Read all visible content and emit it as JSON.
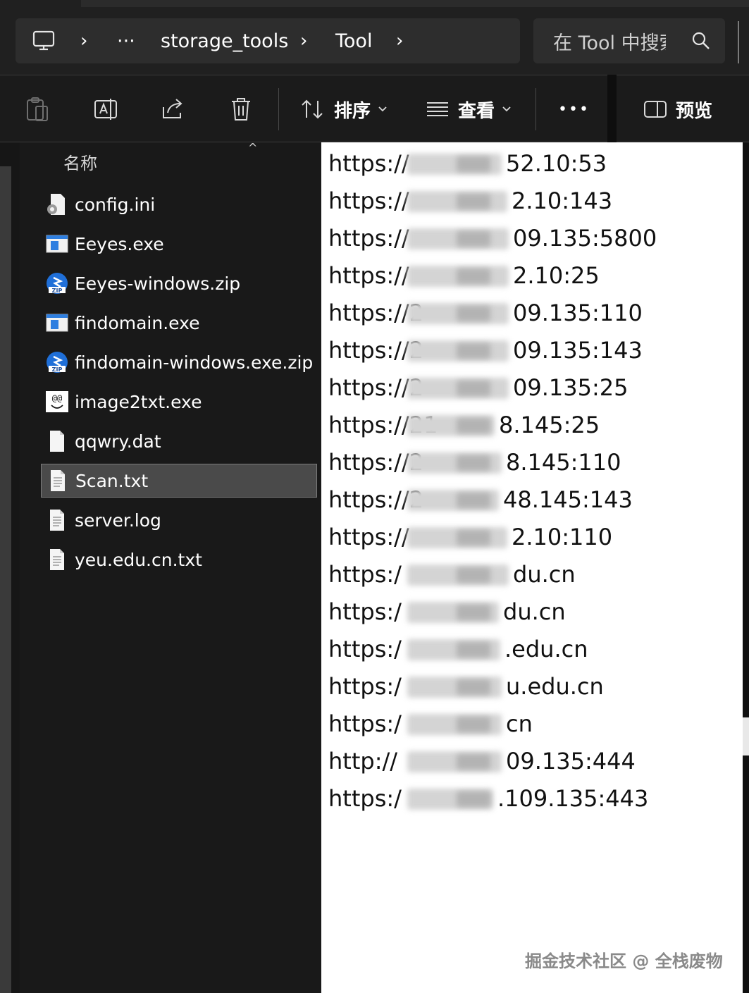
{
  "address_bar": {
    "breadcrumbs": [
      "storage_tools",
      "Tool"
    ],
    "more_label": "···",
    "search_placeholder": "在 Tool 中搜索"
  },
  "command_bar": {
    "sort_label": "排序",
    "view_label": "查看",
    "more_label": "•••",
    "preview_label": "预览"
  },
  "file_list": {
    "column_header": "名称",
    "files": [
      {
        "name": "config.ini",
        "icon": "settings-file-icon"
      },
      {
        "name": "Eeyes.exe",
        "icon": "exe-file-icon"
      },
      {
        "name": "Eeyes-windows.zip",
        "icon": "zip-file-icon"
      },
      {
        "name": "findomain.exe",
        "icon": "exe-file-icon"
      },
      {
        "name": "findomain-windows.exe.zip",
        "icon": "zip-file-icon"
      },
      {
        "name": "image2txt.exe",
        "icon": "image2txt-app-icon"
      },
      {
        "name": "qqwry.dat",
        "icon": "blank-file-icon"
      },
      {
        "name": "Scan.txt",
        "icon": "text-file-icon",
        "selected": true
      },
      {
        "name": "server.log",
        "icon": "text-file-icon"
      },
      {
        "name": "yeu.edu.cn.txt",
        "icon": "text-file-icon"
      }
    ]
  },
  "preview": {
    "lines": [
      {
        "prefix": "https://",
        "suffix": "52.10:53"
      },
      {
        "prefix": "https://",
        "suffix": "2.10:143"
      },
      {
        "prefix": "https://",
        "suffix": "09.135:5800"
      },
      {
        "prefix": "https://",
        "suffix": "2.10:25"
      },
      {
        "prefix": "https://2",
        "suffix": "09.135:110"
      },
      {
        "prefix": "https://2",
        "suffix": "09.135:143"
      },
      {
        "prefix": "https://2",
        "suffix": "09.135:25"
      },
      {
        "prefix": "https://21",
        "suffix": "8.145:25"
      },
      {
        "prefix": "https://2",
        "suffix": "8.145:110"
      },
      {
        "prefix": "https://2",
        "suffix": "48.145:143"
      },
      {
        "prefix": "https://",
        "suffix": "2.10:110"
      },
      {
        "prefix": "https:/",
        "suffix": "du.cn"
      },
      {
        "prefix": "https:/",
        "suffix": "du.cn"
      },
      {
        "prefix": "https:/",
        "suffix": ".edu.cn"
      },
      {
        "prefix": "https:/",
        "suffix": "u.edu.cn"
      },
      {
        "prefix": "https:/",
        "suffix": "cn"
      },
      {
        "prefix": "http://",
        "suffix": "09.135:444"
      },
      {
        "prefix": "https:/",
        "suffix": ".109.135:443"
      }
    ]
  },
  "watermark": "掘金技术社区 @ 全栈废物"
}
